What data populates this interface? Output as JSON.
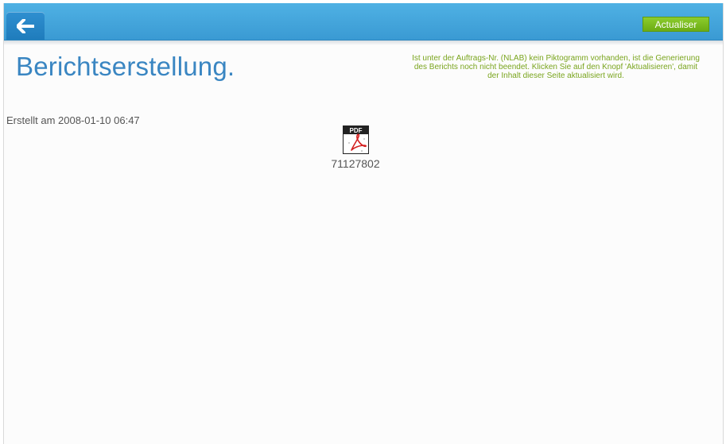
{
  "toolbar": {
    "back_icon": "arrow-left-icon",
    "refresh_label": "Actualiser",
    "refresh_color": "#7bbd1f",
    "bar_color": "#43a5dc"
  },
  "main": {
    "title": "Berichtserstellung.",
    "title_color": "#3a86c2",
    "notice": "Ist unter der Auftrags-Nr. (NLAB) kein Piktogramm vorhanden, ist die Generierung des Berichts noch nicht beendet. Klicken Sie auf den Knopf 'Aktualisieren', damit der Inhalt dieser Seite aktualisiert wird.",
    "notice_color": "#7aa51e",
    "created": "Erstellt am 2008-01-10 06:47"
  },
  "report": {
    "icon": "pdf-file-icon",
    "icon_badge": "PDF",
    "label": "71127802"
  }
}
